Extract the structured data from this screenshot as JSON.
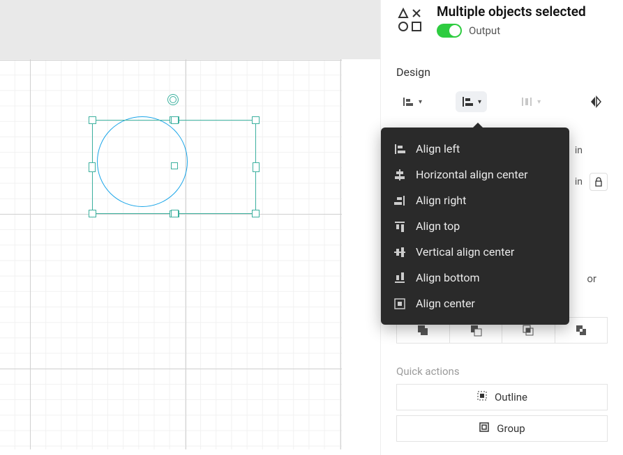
{
  "header": {
    "title": "Multiple objects selected",
    "output_label": "Output",
    "output_enabled": true
  },
  "panel": {
    "section": "Design",
    "units_label": "in",
    "lock_label": "⌘",
    "bool_visible_text": "or"
  },
  "dropdown": {
    "items": [
      {
        "id": "align-left",
        "label": "Align left"
      },
      {
        "id": "h-center",
        "label": "Horizontal align center"
      },
      {
        "id": "align-right",
        "label": "Align right"
      },
      {
        "id": "align-top",
        "label": "Align top"
      },
      {
        "id": "v-center",
        "label": "Vertical align center"
      },
      {
        "id": "align-bottom",
        "label": "Align bottom"
      },
      {
        "id": "align-center",
        "label": "Align center"
      }
    ]
  },
  "quick_actions": {
    "title": "Quick actions",
    "outline": "Outline",
    "group": "Group"
  }
}
